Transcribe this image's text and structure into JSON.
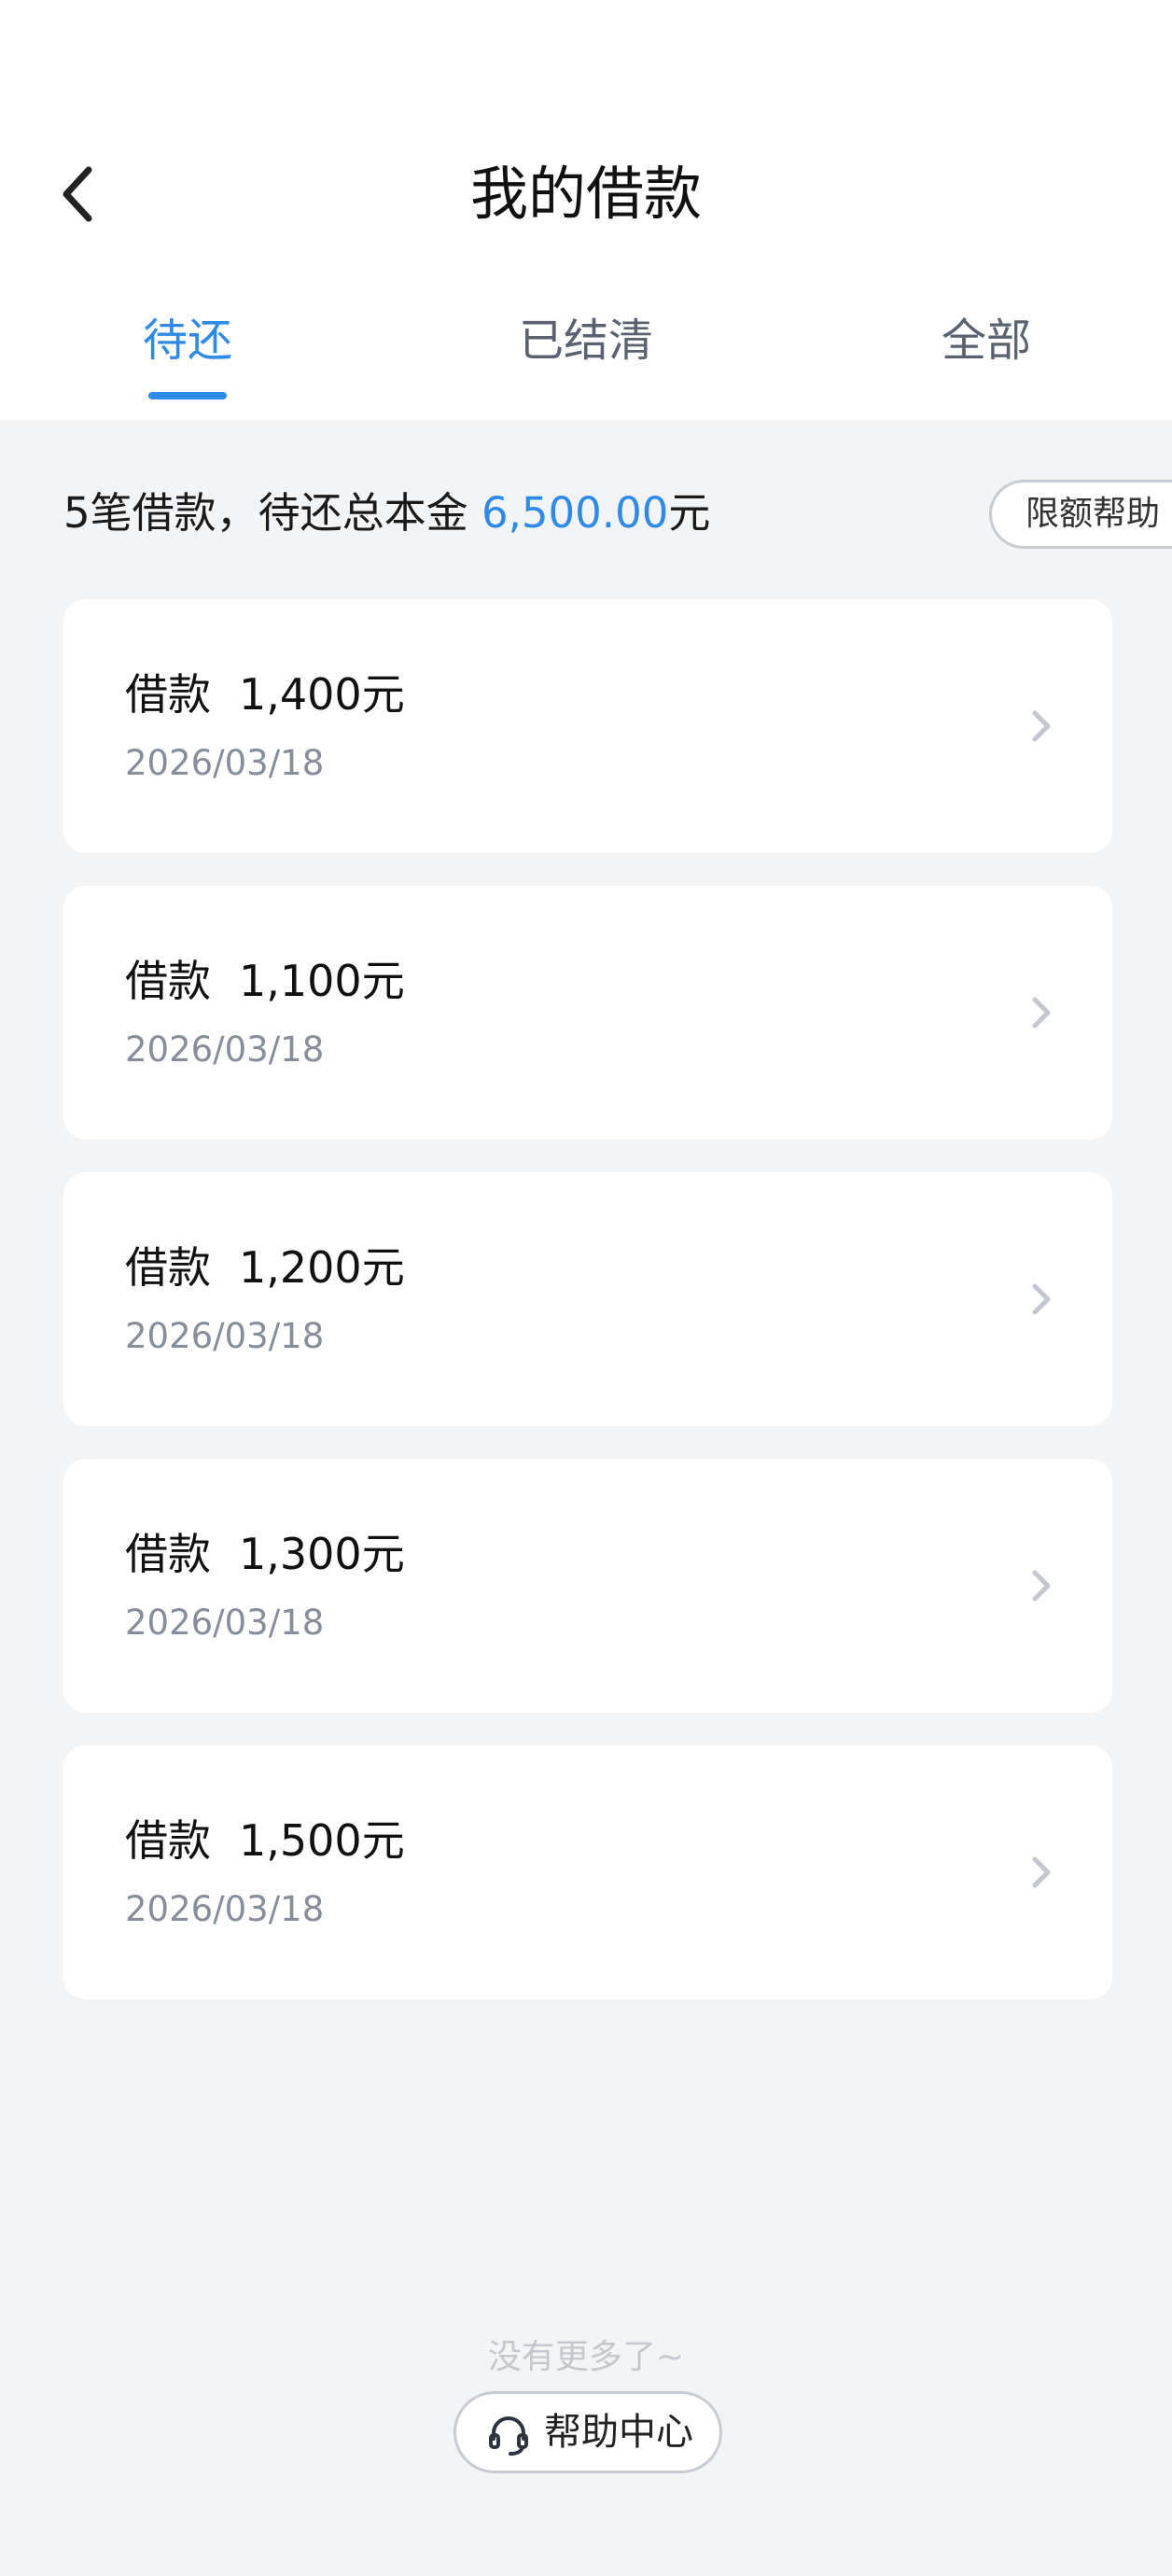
{
  "header": {
    "title": "我的借款",
    "back_icon": "chevron-left-icon"
  },
  "tabs": [
    {
      "label": "待还",
      "active": true
    },
    {
      "label": "已结清",
      "active": false
    },
    {
      "label": "全部",
      "active": false
    }
  ],
  "summary": {
    "prefix": "5笔借款，待还总本金 ",
    "amount": "6,500.00",
    "suffix": "元"
  },
  "limit_help_button": "限额帮助",
  "loans": [
    {
      "label": "借款",
      "amount": "1,400元",
      "date": "2026/03/18"
    },
    {
      "label": "借款",
      "amount": "1,100元",
      "date": "2026/03/18"
    },
    {
      "label": "借款",
      "amount": "1,200元",
      "date": "2026/03/18"
    },
    {
      "label": "借款",
      "amount": "1,300元",
      "date": "2026/03/18"
    },
    {
      "label": "借款",
      "amount": "1,500元",
      "date": "2026/03/18"
    }
  ],
  "footer": {
    "no_more": "没有更多了~",
    "help_center": "帮助中心",
    "help_icon": "headset-icon"
  },
  "colors": {
    "accent": "#2e8ae6",
    "background": "#f3f4f6",
    "card": "#ffffff"
  }
}
